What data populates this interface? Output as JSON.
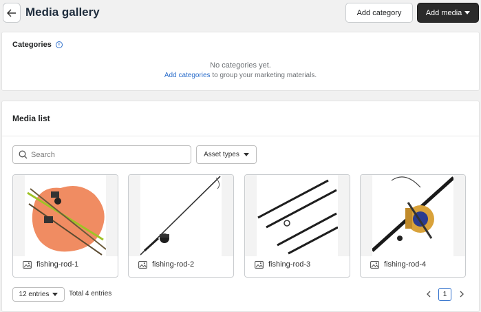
{
  "header": {
    "title": "Media gallery",
    "add_category_label": "Add category",
    "add_media_label": "Add media"
  },
  "categories": {
    "title": "Categories",
    "empty_message": "No categories yet.",
    "link_text": "Add categories",
    "suffix_text": " to group your marketing materials."
  },
  "media_list": {
    "title": "Media list",
    "search_placeholder": "Search",
    "asset_types_label": "Asset types",
    "items": [
      {
        "name": "fishing-rod-1"
      },
      {
        "name": "fishing-rod-2"
      },
      {
        "name": "fishing-rod-3"
      },
      {
        "name": "fishing-rod-4"
      }
    ]
  },
  "pagination": {
    "entries_label": "12 entries",
    "total_label": "Total 4 entries",
    "current_page": "1"
  },
  "icons": [
    "back-arrow-icon",
    "info-icon",
    "search-icon",
    "chevron-down-icon",
    "image-icon",
    "chevron-left-icon",
    "chevron-right-icon"
  ],
  "colors": {
    "primary_button": "#2b2b2b",
    "link": "#2c6ecb",
    "page_background": "#f1f1f1"
  }
}
